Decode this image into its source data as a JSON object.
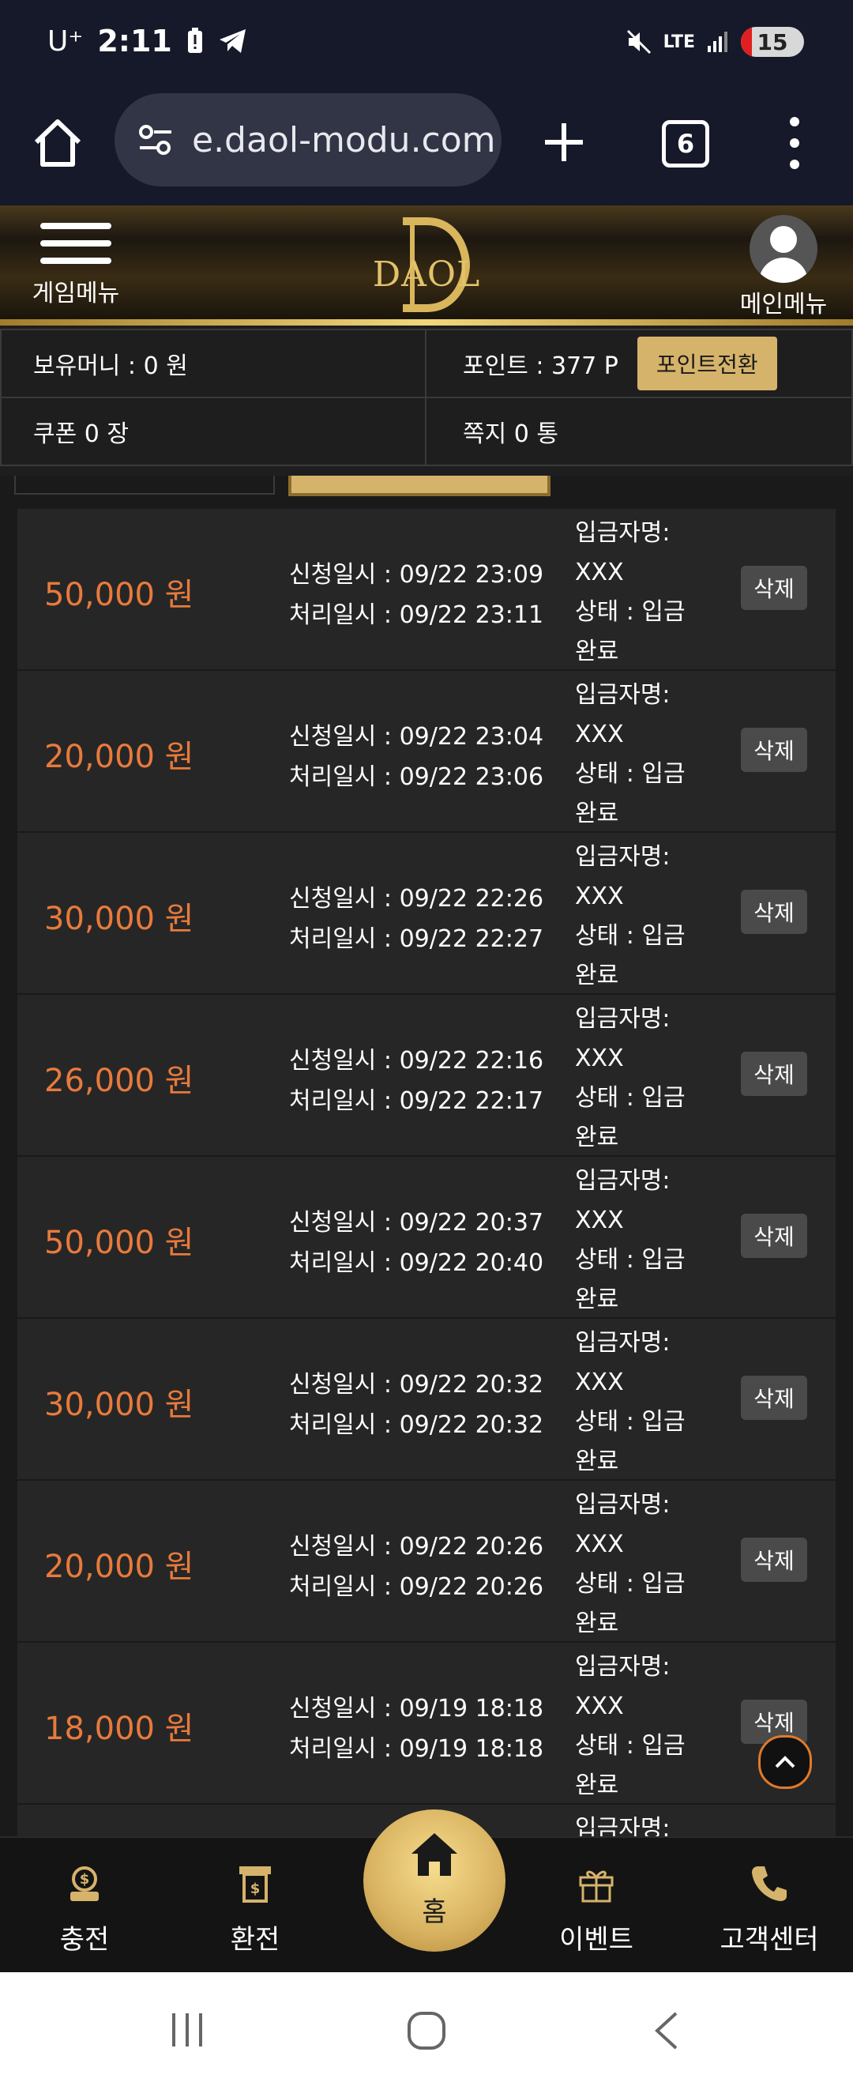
{
  "status_bar": {
    "carrier": "U⁺",
    "time": "2:11",
    "network": "LTE",
    "battery": "15"
  },
  "browser": {
    "url": "e.daol-modu.com",
    "tab_count": "6"
  },
  "header": {
    "game_menu_label": "게임메뉴",
    "logo_text": "DAOL",
    "main_menu_label": "메인메뉴"
  },
  "info": {
    "money": "보유머니 : 0 원",
    "points": "포인트 : 377 P",
    "point_convert_button": "포인트전환",
    "coupon": "쿠폰 0 장",
    "message": "쪽지 0 통"
  },
  "list": {
    "request_label": "신청일시 : ",
    "processed_label": "처리일시 : ",
    "depositor_label": "입금자명:",
    "status_label_1": "상태 : 입금",
    "status_label_2": "완료",
    "delete_label": "삭제",
    "rows": [
      {
        "amount": "50,000 원",
        "requested": "신청일시 : 09/22 23:09",
        "processed": "처리일시 : 09/22 23:11",
        "depositor": "XXX"
      },
      {
        "amount": "20,000 원",
        "requested": "신청일시 : 09/22 23:04",
        "processed": "처리일시 : 09/22 23:06",
        "depositor": "XXX"
      },
      {
        "amount": "30,000 원",
        "requested": "신청일시 : 09/22 22:26",
        "processed": "처리일시 : 09/22 22:27",
        "depositor": "XXX"
      },
      {
        "amount": "26,000 원",
        "requested": "신청일시 : 09/22 22:16",
        "processed": "처리일시 : 09/22 22:17",
        "depositor": "XXX"
      },
      {
        "amount": "50,000 원",
        "requested": "신청일시 : 09/22 20:37",
        "processed": "처리일시 : 09/22 20:40",
        "depositor": "XXX"
      },
      {
        "amount": "30,000 원",
        "requested": "신청일시 : 09/22 20:32",
        "processed": "처리일시 : 09/22 20:32",
        "depositor": "XXX"
      },
      {
        "amount": "20,000 원",
        "requested": "신청일시 : 09/22 20:26",
        "processed": "처리일시 : 09/22 20:26",
        "depositor": "XXX"
      },
      {
        "amount": "18,000 원",
        "requested": "신청일시 : 09/19 18:18",
        "processed": "처리일시 : 09/19 18:18",
        "depositor": "XXX"
      }
    ],
    "partial_row_label": "입금자명:"
  },
  "bottom_nav": {
    "charge": "충전",
    "exchange": "환전",
    "home": "홈",
    "event": "이벤트",
    "support": "고객센터"
  },
  "colors": {
    "accent_gold": "#d6b36b",
    "amount_orange": "#e87a3c"
  }
}
